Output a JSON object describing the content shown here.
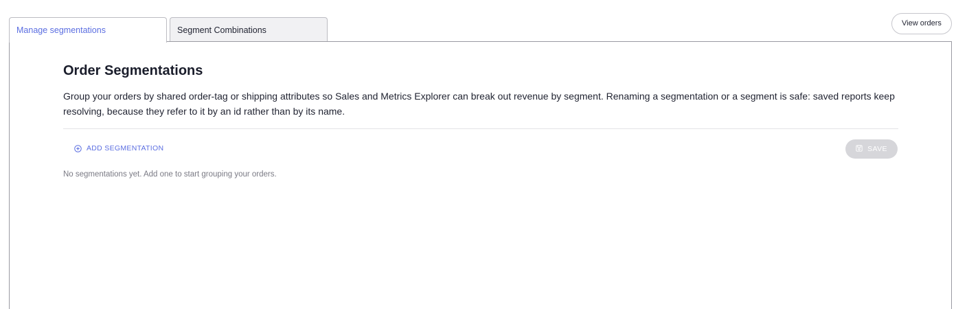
{
  "tabs": [
    {
      "label": "Manage segmentations",
      "active": true
    },
    {
      "label": "Segment Combinations",
      "active": false
    }
  ],
  "header": {
    "view_orders_label": "View orders"
  },
  "main": {
    "title": "Order Segmentations",
    "description": "Group your orders by shared order-tag or shipping attributes so Sales and Metrics Explorer can break out revenue by segment. Renaming a segmentation or a segment is safe: saved reports keep resolving, because they refer to it by an id rather than by its name.",
    "add_label": "ADD SEGMENTATION",
    "add_icon": "plus-circle-icon",
    "save_label": "SAVE",
    "save_icon": "floppy-disk-icon",
    "save_disabled": true,
    "empty_message": "No segmentations yet. Add one to start grouping your orders."
  },
  "colors": {
    "accent": "#5b6ee1",
    "disabled_button": "#d6d6da",
    "inactive_tab": "#f1f1f3"
  }
}
